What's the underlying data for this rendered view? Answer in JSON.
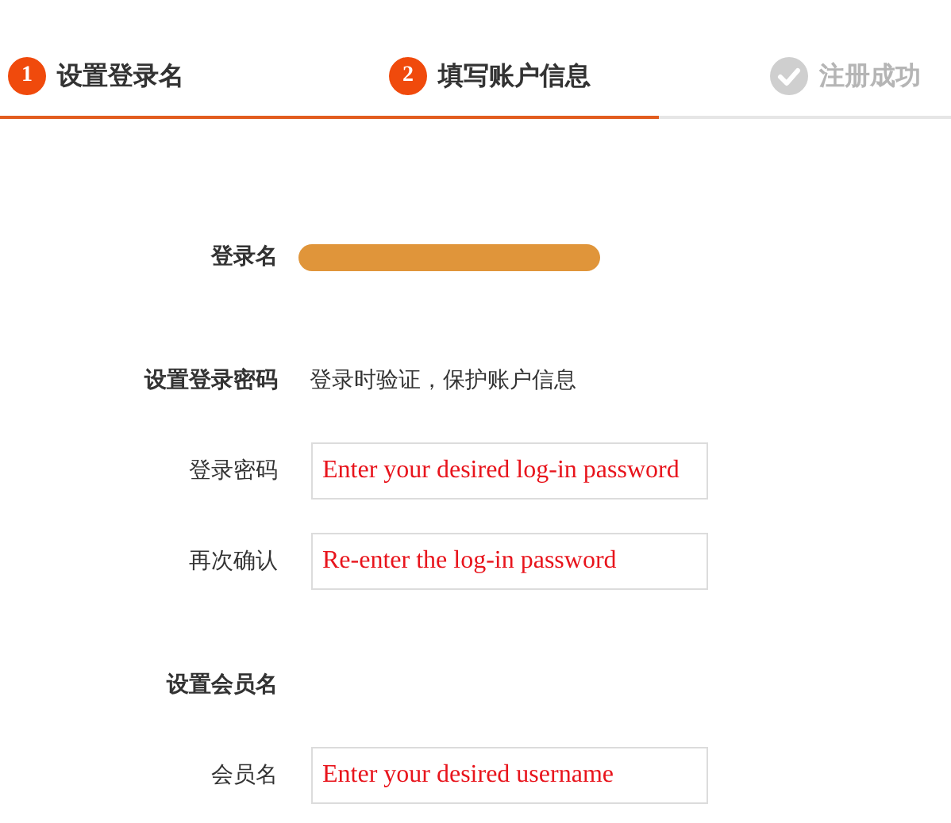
{
  "steps": [
    {
      "number": "1",
      "label": "设置登录名",
      "active": true
    },
    {
      "number": "2",
      "label": "填写账户信息",
      "active": true
    },
    {
      "label": "注册成功",
      "active": false
    }
  ],
  "progress": {
    "level": 0.693
  },
  "form": [
    {
      "kind": "redacted",
      "label": "登录名"
    },
    {
      "kind": "section",
      "label": "设置登录密码",
      "hint": "登录时验证，保护账户信息"
    },
    {
      "kind": "field",
      "label": "登录密码",
      "value": "Enter your desired log-in password"
    },
    {
      "kind": "field",
      "label": "再次确认",
      "value": "Re-enter the log-in password"
    },
    {
      "kind": "section",
      "label": "设置会员名"
    },
    {
      "kind": "field",
      "label": "会员名",
      "value": "Enter your desired username"
    }
  ]
}
